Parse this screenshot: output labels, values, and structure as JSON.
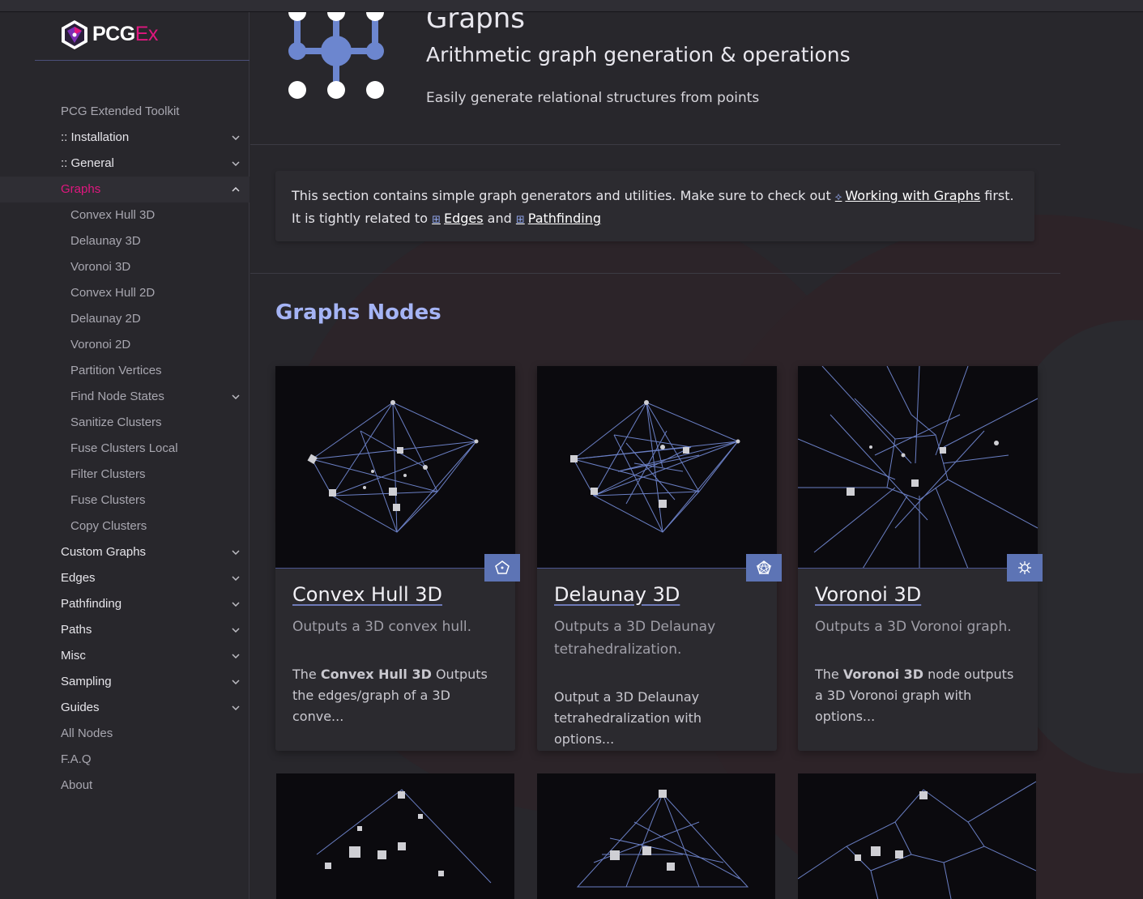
{
  "logo": {
    "part1": "PCG",
    "part2": "Ex"
  },
  "sidebar": {
    "items": [
      {
        "label": "PCG Extended Toolkit",
        "style": "muted"
      },
      {
        "label": ":: Installation",
        "chevron": "down"
      },
      {
        "label": ":: General",
        "chevron": "down"
      },
      {
        "label": "Graphs",
        "chevron": "up",
        "active": true
      },
      {
        "label": "Convex Hull 3D",
        "style": "sub"
      },
      {
        "label": "Delaunay 3D",
        "style": "sub"
      },
      {
        "label": "Voronoi 3D",
        "style": "sub"
      },
      {
        "label": "Convex Hull 2D",
        "style": "sub"
      },
      {
        "label": "Delaunay 2D",
        "style": "sub"
      },
      {
        "label": "Voronoi 2D",
        "style": "sub"
      },
      {
        "label": "Partition Vertices",
        "style": "sub"
      },
      {
        "label": "Find Node States",
        "style": "sub",
        "chevron": "down"
      },
      {
        "label": "Sanitize Clusters",
        "style": "sub"
      },
      {
        "label": "Fuse Clusters Local",
        "style": "sub"
      },
      {
        "label": "Filter Clusters",
        "style": "sub"
      },
      {
        "label": "Fuse Clusters",
        "style": "sub"
      },
      {
        "label": "Copy Clusters",
        "style": "sub"
      },
      {
        "label": "Custom Graphs",
        "chevron": "down"
      },
      {
        "label": "Edges",
        "chevron": "down"
      },
      {
        "label": "Pathfinding",
        "chevron": "down"
      },
      {
        "label": "Paths",
        "chevron": "down"
      },
      {
        "label": "Misc",
        "chevron": "down"
      },
      {
        "label": "Sampling",
        "chevron": "down"
      },
      {
        "label": "Guides",
        "chevron": "down"
      },
      {
        "label": "All Nodes",
        "style": "muted"
      },
      {
        "label": "F.A.Q",
        "style": "muted"
      },
      {
        "label": "About",
        "style": "muted"
      }
    ]
  },
  "hero": {
    "title": "Graphs",
    "subtitle": "Arithmetic graph generation & operations",
    "description": "Easily generate relational structures from points"
  },
  "note": {
    "line1_prefix": "This section contains simple graph generators and utilities. Make sure to check out ",
    "link1": "Working with Graphs",
    "line1_suffix": " first.",
    "line2_prefix": "It is tightly related to ",
    "link2": "Edges",
    "line2_mid": " and ",
    "link3": "Pathfinding"
  },
  "section_title": "Graphs Nodes",
  "cards": [
    {
      "title": "Convex Hull 3D",
      "desc": "Outputs a 3D convex hull.",
      "body_pre": "The ",
      "body_bold": "Convex Hull 3D",
      "body_post": " Outputs the edges/graph of a 3D conve..."
    },
    {
      "title": "Delaunay 3D",
      "desc": "Outputs a 3D Delaunay tetrahedralization.",
      "body": "Output a 3D Delaunay tetrahedralization with options..."
    },
    {
      "title": "Voronoi 3D",
      "desc": "Outputs a 3D Voronoi graph.",
      "body_pre": "The ",
      "body_bold": "Voronoi 3D",
      "body_post": " node outputs a 3D Voronoi graph with options..."
    }
  ],
  "colors": {
    "accent": "#e0177f",
    "link": "#a5b4f5",
    "badge": "#5d74b5"
  }
}
